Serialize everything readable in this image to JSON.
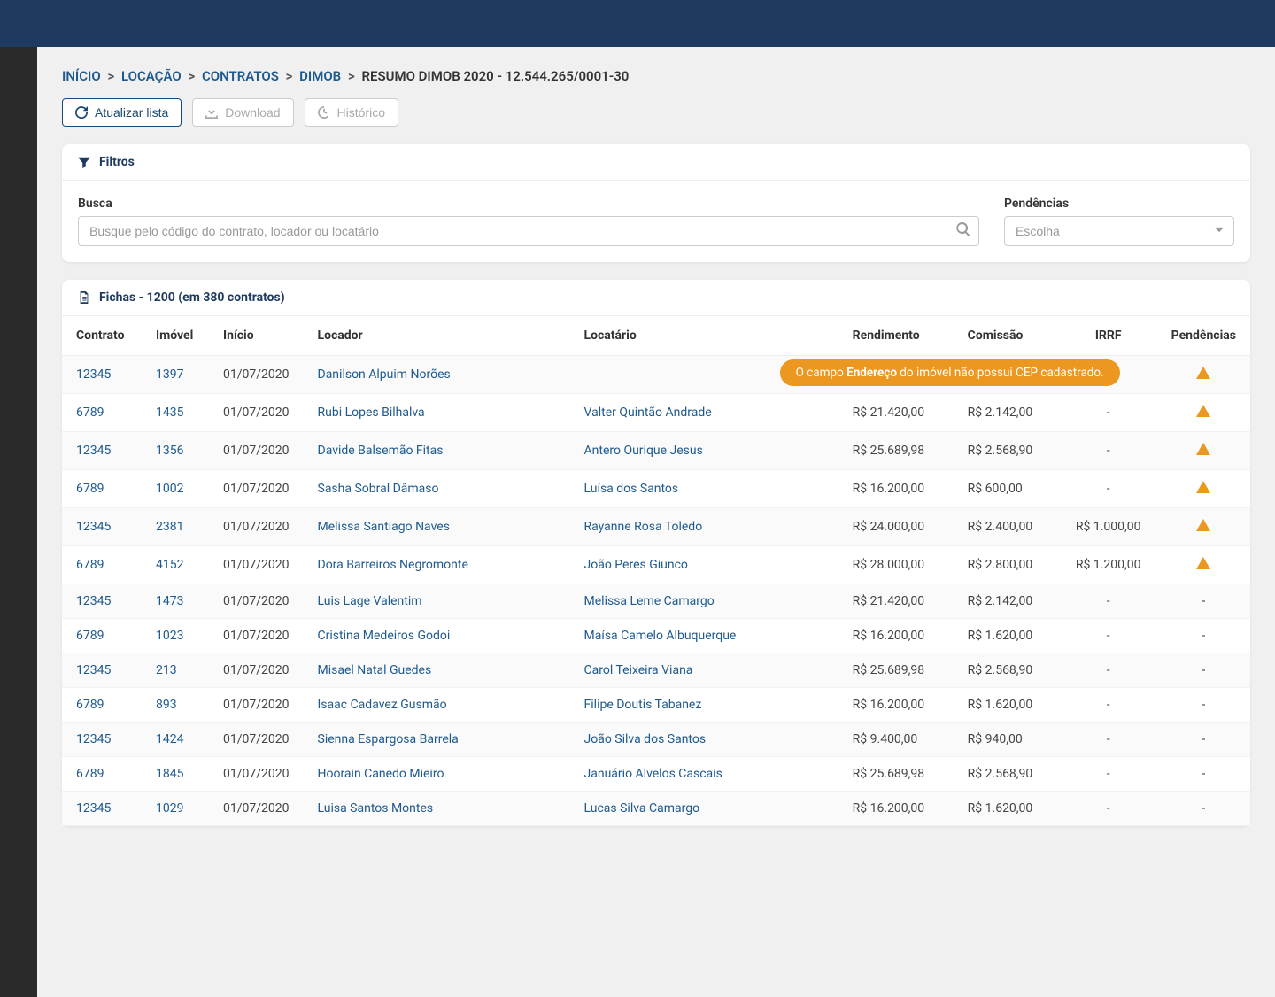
{
  "breadcrumb": {
    "items": [
      "INÍCIO",
      "LOCAÇÃO",
      "CONTRATOS",
      "DIMOB"
    ],
    "current": "RESUMO DIMOB 2020 - 12.544.265/0001-30"
  },
  "toolbar": {
    "refresh": "Atualizar lista",
    "download": "Download",
    "history": "Histórico"
  },
  "filters": {
    "title": "Filtros",
    "search_label": "Busca",
    "search_placeholder": "Busque pelo código do contrato, locador ou locatário",
    "pend_label": "Pendências",
    "pend_placeholder": "Escolha"
  },
  "table": {
    "title": "Fichas - 1200 (em 380 contratos)",
    "headers": {
      "contrato": "Contrato",
      "imovel": "Imóvel",
      "inicio": "Início",
      "locador": "Locador",
      "locatario": "Locatário",
      "rendimento": "Rendimento",
      "comissao": "Comissão",
      "irrf": "IRRF",
      "pendencias": "Pendências"
    },
    "tooltip": {
      "prefix": "O campo ",
      "bold": "Endereço",
      "suffix": " do imóvel não possui CEP cadastrado."
    },
    "rows": [
      {
        "contrato": "12345",
        "imovel": "1397",
        "inicio": "01/07/2020",
        "locador": "Danilson Alpuim Norões",
        "locatario": "",
        "rendimento": "",
        "comissao": "",
        "irrf": "",
        "warn": true,
        "tooltip": true
      },
      {
        "contrato": "6789",
        "imovel": "1435",
        "inicio": "01/07/2020",
        "locador": "Rubi Lopes Bilhalva",
        "locatario": "Valter Quintão Andrade",
        "rendimento": "R$ 21.420,00",
        "comissao": "R$ 2.142,00",
        "irrf": "-",
        "warn": true
      },
      {
        "contrato": "12345",
        "imovel": "1356",
        "inicio": "01/07/2020",
        "locador": "Davide Balsemão Fitas",
        "locatario": "Antero Ourique Jesus",
        "rendimento": "R$ 25.689,98",
        "comissao": "R$ 2.568,90",
        "irrf": "-",
        "warn": true
      },
      {
        "contrato": "6789",
        "imovel": "1002",
        "inicio": "01/07/2020",
        "locador": "Sasha Sobral Dâmaso",
        "locatario": "Luísa dos Santos",
        "rendimento": "R$ 16.200,00",
        "comissao": "R$ 600,00",
        "irrf": "-",
        "warn": true
      },
      {
        "contrato": "12345",
        "imovel": "2381",
        "inicio": "01/07/2020",
        "locador": "Melissa Santiago Naves",
        "locatario": "Rayanne Rosa Toledo",
        "rendimento": "R$ 24.000,00",
        "comissao": "R$ 2.400,00",
        "irrf": "R$ 1.000,00",
        "warn": true
      },
      {
        "contrato": "6789",
        "imovel": "4152",
        "inicio": "01/07/2020",
        "locador": "Dora Barreiros Negromonte",
        "locatario": "João Peres Giunco",
        "rendimento": "R$ 28.000,00",
        "comissao": "R$ 2.800,00",
        "irrf": "R$ 1.200,00",
        "warn": true
      },
      {
        "contrato": "12345",
        "imovel": "1473",
        "inicio": "01/07/2020",
        "locador": "Luis Lage Valentim",
        "locatario": "Melissa Leme Camargo",
        "rendimento": "R$ 21.420,00",
        "comissao": "R$ 2.142,00",
        "irrf": "-",
        "warn": false
      },
      {
        "contrato": "6789",
        "imovel": "1023",
        "inicio": "01/07/2020",
        "locador": "Cristina Medeiros Godoi",
        "locatario": "Maísa Camelo Albuquerque",
        "rendimento": "R$ 16.200,00",
        "comissao": "R$ 1.620,00",
        "irrf": "-",
        "warn": false
      },
      {
        "contrato": "12345",
        "imovel": "213",
        "inicio": "01/07/2020",
        "locador": "Misael Natal Guedes",
        "locatario": "Carol Teixeira Viana",
        "rendimento": "R$ 25.689,98",
        "comissao": "R$ 2.568,90",
        "irrf": "-",
        "warn": false
      },
      {
        "contrato": "6789",
        "imovel": "893",
        "inicio": "01/07/2020",
        "locador": "Isaac Cadavez Gusmão",
        "locatario": "Filipe Doutis Tabanez",
        "rendimento": "R$ 16.200,00",
        "comissao": "R$ 1.620,00",
        "irrf": "-",
        "warn": false
      },
      {
        "contrato": "12345",
        "imovel": "1424",
        "inicio": "01/07/2020",
        "locador": "Sienna Espargosa Barrela",
        "locatario": "João Silva dos Santos",
        "rendimento": "R$ 9.400,00",
        "comissao": "R$ 940,00",
        "irrf": "-",
        "warn": false
      },
      {
        "contrato": "6789",
        "imovel": "1845",
        "inicio": "01/07/2020",
        "locador": "Hoorain Canedo Mieiro",
        "locatario": "Januário Alvelos Cascais",
        "rendimento": "R$ 25.689,98",
        "comissao": "R$ 2.568,90",
        "irrf": "-",
        "warn": false
      },
      {
        "contrato": "12345",
        "imovel": "1029",
        "inicio": "01/07/2020",
        "locador": "Luisa Santos Montes",
        "locatario": "Lucas Silva Camargo",
        "rendimento": "R$ 16.200,00",
        "comissao": "R$ 1.620,00",
        "irrf": "-",
        "warn": false
      }
    ]
  }
}
